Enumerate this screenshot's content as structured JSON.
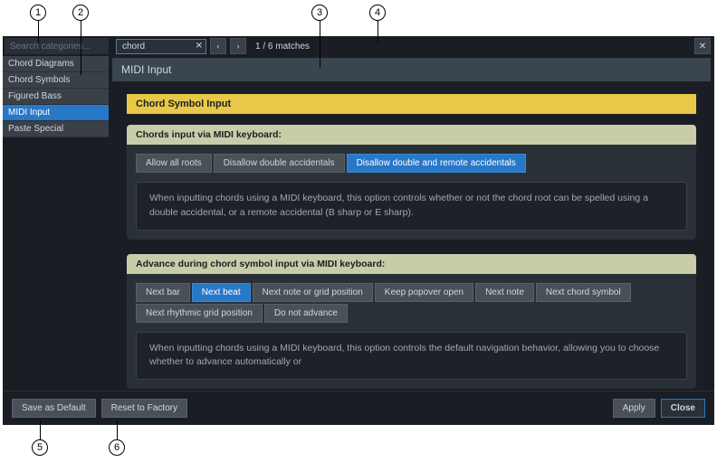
{
  "callouts": [
    "1",
    "2",
    "3",
    "4",
    "5",
    "6"
  ],
  "search": {
    "categories_placeholder": "Search categories...",
    "options_value": "chord",
    "match_text": "1 / 6 matches"
  },
  "sidebar": {
    "items": [
      {
        "label": "Chord Diagrams"
      },
      {
        "label": "Chord Symbols"
      },
      {
        "label": "Figured Bass"
      },
      {
        "label": "MIDI Input"
      },
      {
        "label": "Paste Special"
      }
    ]
  },
  "page": {
    "title": "MIDI Input",
    "section_title": "Chord Symbol Input",
    "groups": [
      {
        "label": "Chords input via MIDI keyboard:",
        "options": [
          {
            "text": "Allow all roots"
          },
          {
            "text": "Disallow double accidentals"
          },
          {
            "text": "Disallow double and remote accidentals"
          }
        ],
        "selected": 2,
        "desc": "When inputting chords using a MIDI keyboard, this option controls whether or not the chord root can be spelled using a double accidental, or a remote accidental (B sharp or E sharp)."
      },
      {
        "label": "Advance during chord symbol input via MIDI keyboard:",
        "options": [
          {
            "text": "Next bar"
          },
          {
            "text": "Next beat"
          },
          {
            "text": "Next note or grid position"
          },
          {
            "text": "Keep popover open"
          },
          {
            "text": "Next note"
          },
          {
            "text": "Next chord symbol"
          },
          {
            "text": "Next rhythmic grid position"
          },
          {
            "text": "Do not advance"
          }
        ],
        "selected": 1,
        "desc": "When inputting chords using a MIDI keyboard, this option controls the default navigation behavior, allowing you to choose whether to advance automatically or"
      }
    ]
  },
  "footer": {
    "save_default": "Save as Default",
    "reset_factory": "Reset to Factory",
    "apply": "Apply",
    "close": "Close"
  }
}
